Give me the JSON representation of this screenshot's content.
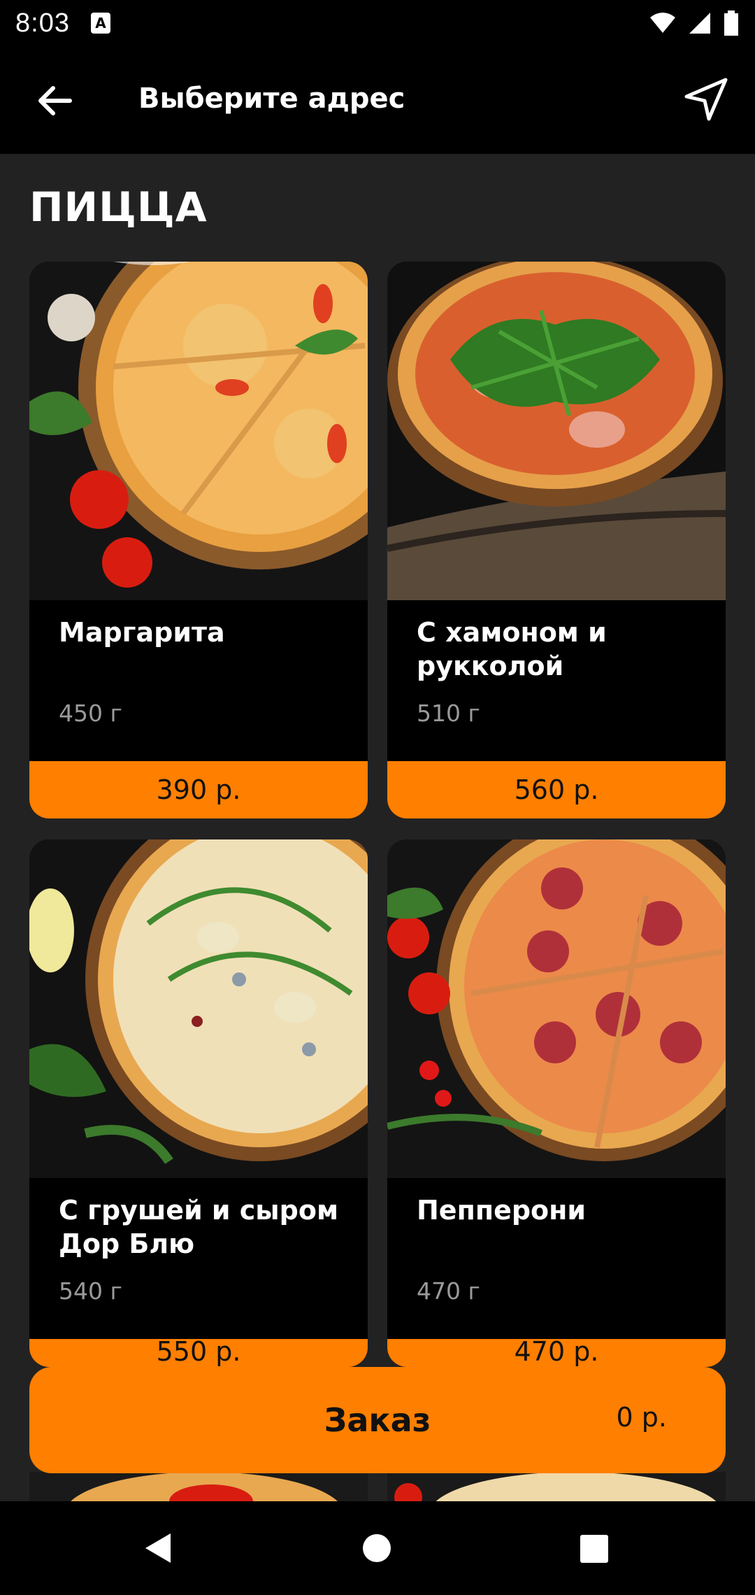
{
  "status_bar": {
    "time": "8:03",
    "notification_icon": "A"
  },
  "app_bar": {
    "title": "Выберите адрес",
    "back_icon": "arrow-left-icon",
    "location_icon": "navigation-arrow-icon"
  },
  "section": {
    "title": "ПИЦЦА"
  },
  "products": [
    {
      "name": "Маргарита",
      "weight": "450 г",
      "price": "390 р."
    },
    {
      "name": "С хамоном и рукколой",
      "weight": "510 г",
      "price": "560 р."
    },
    {
      "name": "С грушей и сыром Дор Блю",
      "weight": "540 г",
      "price": "550 р."
    },
    {
      "name": "Пепперони",
      "weight": "470 г",
      "price": "470 р."
    }
  ],
  "order": {
    "label": "Заказ",
    "total": "0 р."
  },
  "colors": {
    "accent": "#ff7f00",
    "background": "#222222",
    "card": "#000000"
  }
}
